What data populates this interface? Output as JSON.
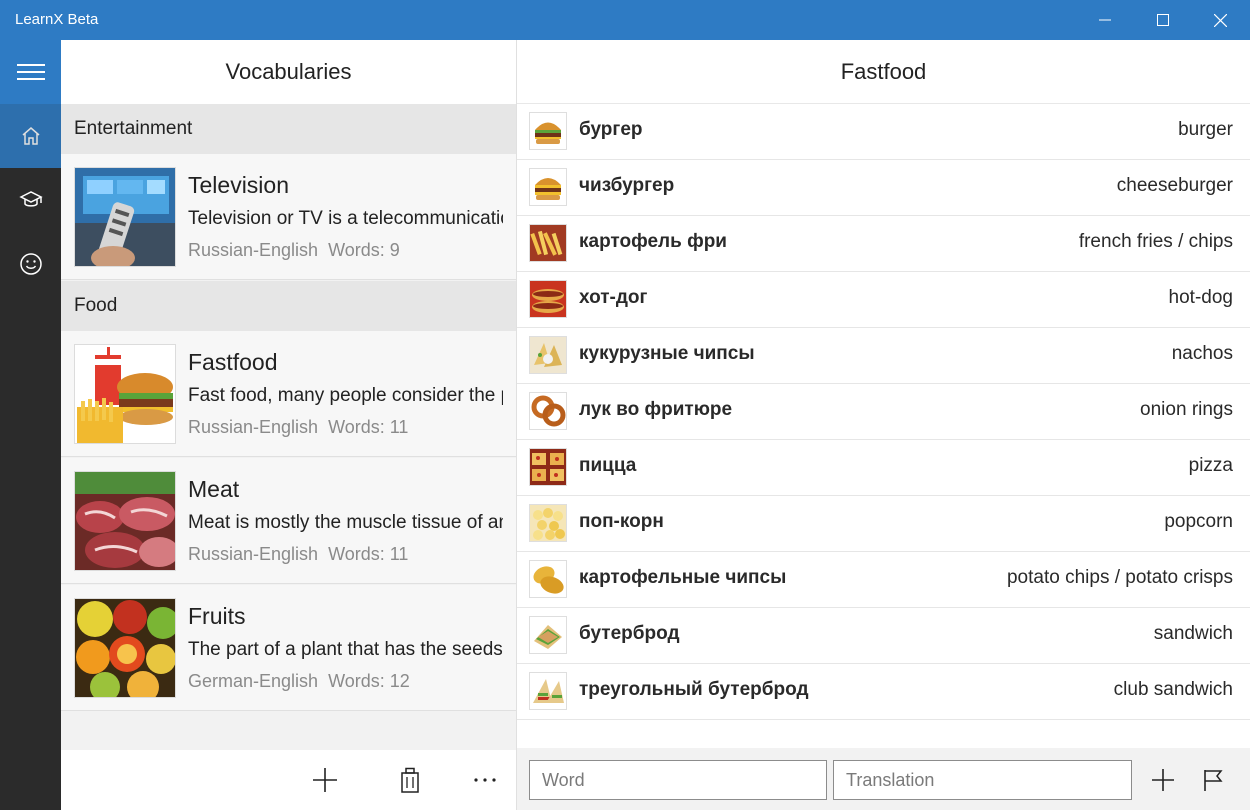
{
  "window": {
    "title": "LearnX Beta",
    "controls": [
      "minimize-icon",
      "maximize-icon",
      "close-icon"
    ]
  },
  "rail": {
    "items": [
      {
        "icon": "hamburger-menu-icon"
      },
      {
        "icon": "home-icon"
      },
      {
        "icon": "graduation-cap-icon"
      },
      {
        "icon": "smiley-icon"
      }
    ]
  },
  "vocabularies": {
    "title": "Vocabularies",
    "groups": [
      {
        "name": "Entertainment",
        "items": [
          {
            "name": "Television",
            "description": "Television or TV is a telecommunication medium used for transmitting moving images",
            "languages": "Russian-English",
            "words": "Words: 9"
          }
        ]
      },
      {
        "name": "Food",
        "items": [
          {
            "name": "Fastfood",
            "description": "Fast food, many people consider the popular",
            "languages": "Russian-English",
            "words": "Words: 11"
          },
          {
            "name": "Meat",
            "description": "Meat is mostly the muscle tissue of an animal",
            "languages": "Russian-English",
            "words": "Words: 11"
          },
          {
            "name": "Fruits",
            "description": "The part of a plant that has the seeds",
            "languages": "German-English",
            "words": "Words: 12"
          }
        ]
      }
    ],
    "toolbar": [
      "add-icon",
      "delete-icon",
      "more-icon"
    ]
  },
  "words": {
    "title": "Fastfood",
    "items": [
      {
        "ru": "бургер",
        "en": "burger"
      },
      {
        "ru": "чизбургер",
        "en": "cheeseburger"
      },
      {
        "ru": "картофель фри",
        "en": "french fries / chips"
      },
      {
        "ru": "хот-дог",
        "en": "hot-dog"
      },
      {
        "ru": "кукурузные чипсы",
        "en": "nachos"
      },
      {
        "ru": "лук во фритюре",
        "en": "onion rings"
      },
      {
        "ru": "пицца",
        "en": "pizza"
      },
      {
        "ru": "поп-корн",
        "en": "popcorn"
      },
      {
        "ru": "картофельные чипсы",
        "en": "potato chips / potato crisps"
      },
      {
        "ru": "бутерброд",
        "en": "sandwich"
      },
      {
        "ru": "треугольный бутерброд",
        "en": "club sandwich"
      }
    ],
    "word_placeholder": "Word",
    "translation_placeholder": "Translation",
    "toolbar": [
      "add-icon",
      "flag-icon"
    ]
  },
  "colors": {
    "accent": "#2e7bc4",
    "rail": "#2b2b2b"
  }
}
